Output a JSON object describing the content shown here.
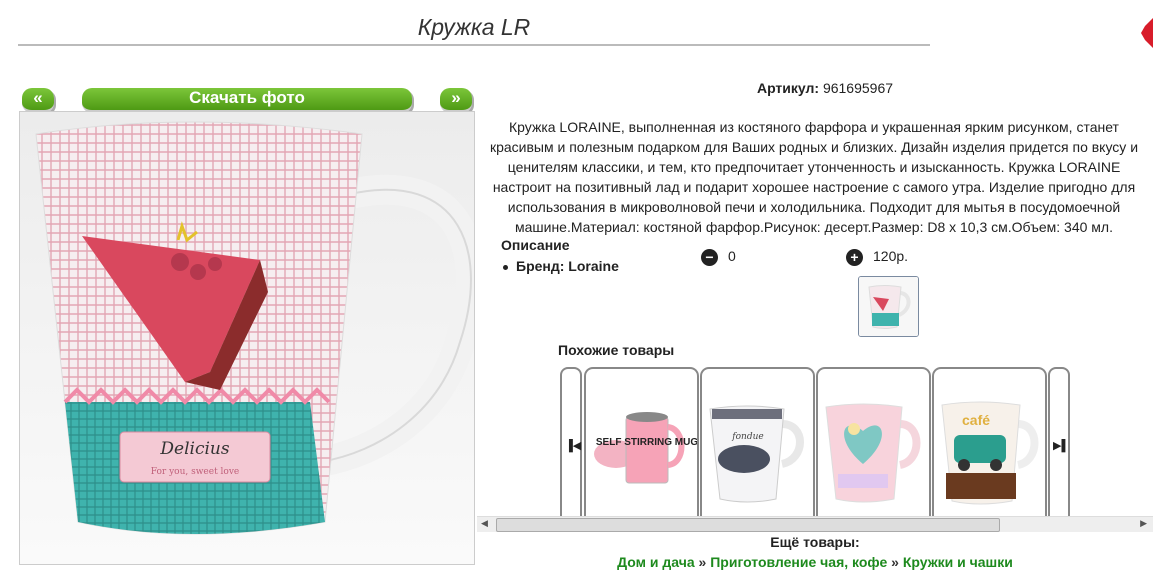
{
  "page": {
    "title": "Кружка LR"
  },
  "gallery": {
    "prev": "«",
    "next": "»",
    "download": "Скачать фото"
  },
  "product": {
    "article_label": "Артикул:",
    "article_value": "961695967",
    "description": "Кружка LORAINE, выполненная из костяного фарфора и украшенная ярким рисунком, станет красивым и полезным подарком для Ваших родных и близких. Дизайн изделия придется по вкусу и ценителям классики, и тем, кто предпочитает утонченность и изысканность. Кружка LORAINE настроит на позитивный лад и подарит хорошее настроение с самого утра. Изделие пригодно для использования в микроволновой печи и холодильника. Подходит для мытья в посудомоечной машине.Материал: костяной фарфор.Рисунок: десерт.Размер: D8 x 10,3 см.Объем: 340 мл.",
    "meta_title": "Описание",
    "brand": "Бренд: Loraine",
    "quantity": "0",
    "price": "120р.",
    "mug_text": "Delicius",
    "mug_subtext": "For you, sweet love"
  },
  "similar": {
    "title": "Похожие товары",
    "items": [
      {
        "label": "SELF STIRRING MUG"
      },
      {
        "label": "fondue"
      },
      {
        "label": ""
      },
      {
        "label": "café"
      }
    ]
  },
  "more": {
    "title": "Ещё товары:"
  },
  "breadcrumb": [
    "Дом и дача",
    "Приготовление чая, кофе",
    "Кружки и чашки"
  ],
  "colors": {
    "accent": "#5aa81d",
    "link": "#1e8a1e"
  }
}
